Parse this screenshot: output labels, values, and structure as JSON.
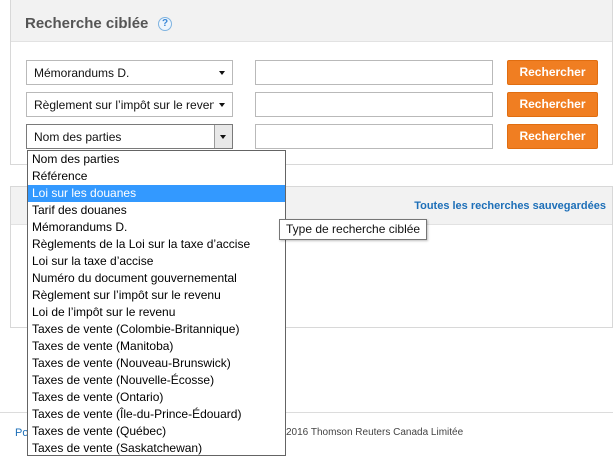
{
  "panel": {
    "title": "Recherche ciblée",
    "help_icon": "?"
  },
  "rows": [
    {
      "select_value": "Mémorandums D.",
      "input_value": "",
      "button_label": "Rechercher"
    },
    {
      "select_value": "Règlement sur l’impôt sur le revenu",
      "input_value": "",
      "button_label": "Rechercher"
    },
    {
      "select_value": "Nom des parties",
      "input_value": "",
      "button_label": "Rechercher"
    }
  ],
  "saved_searches_link": "Toutes les recherches sauvegardées",
  "dropdown": {
    "options": [
      "Nom des parties",
      "Référence",
      "Loi sur les douanes",
      "Tarif des douanes",
      "Mémorandums D.",
      "Règlements de la Loi sur la taxe d’accise",
      "Loi sur la taxe d’accise",
      "Numéro du document gouvernemental",
      "Règlement sur l’impôt sur le revenu",
      "Loi de l’impôt sur le revenu",
      "Taxes de vente (Colombie-Britannique)",
      "Taxes de vente (Manitoba)",
      "Taxes de vente (Nouveau-Brunswick)",
      "Taxes de vente (Nouvelle-Écosse)",
      "Taxes de vente (Ontario)",
      "Taxes de vente (Île-du-Prince-Édouard)",
      "Taxes de vente (Québec)",
      "Taxes de vente (Saskatchewan)"
    ],
    "highlighted": "Loi sur les douanes"
  },
  "tooltip": "Type de recherche ciblée",
  "footer": {
    "left_link": "Po",
    "copyright": "2016 Thomson Reuters Canada Limitée"
  },
  "colors": {
    "button_orange": "#f07e22",
    "highlight_blue": "#3399ff",
    "link_blue": "#1d6fb8"
  }
}
